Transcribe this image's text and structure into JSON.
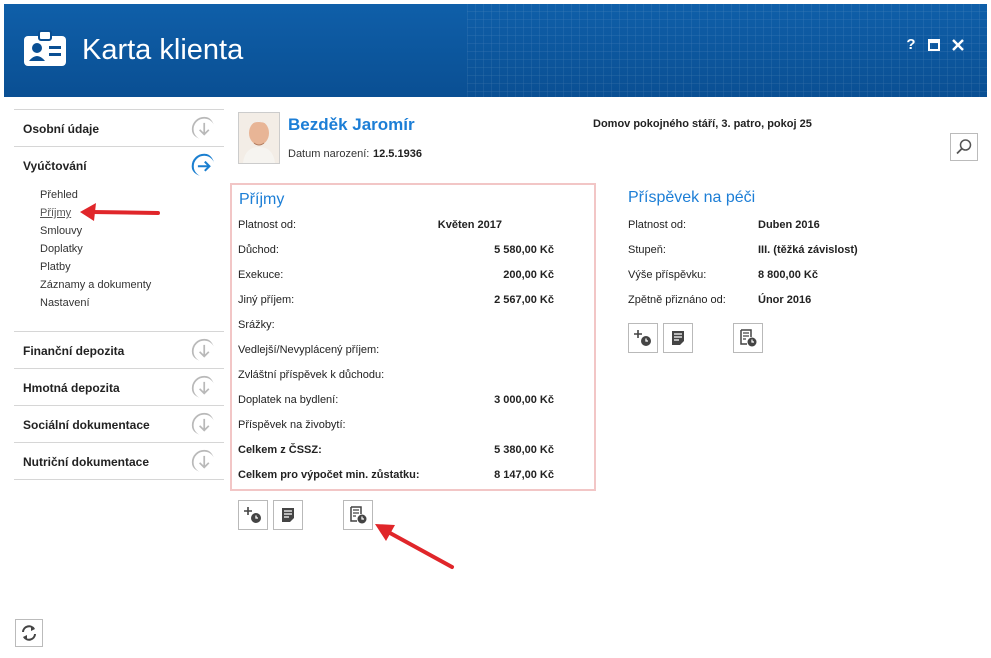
{
  "app": {
    "title": "Karta klienta",
    "help": "?"
  },
  "sidebar": {
    "sections": [
      {
        "label": "Osobní údaje"
      },
      {
        "label": "Vyúčtování"
      },
      {
        "label": "Finanční depozita"
      },
      {
        "label": "Hmotná depozita"
      },
      {
        "label": "Sociální dokumentace"
      },
      {
        "label": "Nutriční dokumentace"
      }
    ],
    "subitems": [
      "Přehled",
      "Příjmy",
      "Smlouvy",
      "Doplatky",
      "Platby",
      "Záznamy a dokumenty",
      "Nastavení"
    ]
  },
  "client": {
    "name": "Bezděk Jaromír",
    "birth_label": "Datum narození:",
    "birth_date": "12.5.1936",
    "residence": "Domov pokojného stáří, 3. patro, pokoj 25"
  },
  "income": {
    "title": "Příjmy",
    "rows": [
      {
        "label": "Platnost od:",
        "value": "Květen 2017"
      },
      {
        "label": "Důchod:",
        "value": "5 580,00 Kč"
      },
      {
        "label": "Exekuce:",
        "value": "200,00 Kč"
      },
      {
        "label": "Jiný příjem:",
        "value": "2 567,00 Kč"
      },
      {
        "label": "Srážky:",
        "value": ""
      },
      {
        "label": "Vedlejší/Nevyplácený příjem:",
        "value": ""
      },
      {
        "label": "Zvláštní příspěvek k důchodu:",
        "value": ""
      },
      {
        "label": "Doplatek na bydlení:",
        "value": "3 000,00 Kč"
      },
      {
        "label": "Příspěvek na živobytí:",
        "value": ""
      },
      {
        "label": "Celkem z ČSSZ:",
        "value": "5 380,00 Kč"
      },
      {
        "label": "Celkem pro výpočet min. zůstatku:",
        "value": "8 147,00 Kč"
      }
    ]
  },
  "care": {
    "title": "Příspěvek na péči",
    "rows": [
      {
        "label": "Platnost od:",
        "value": "Duben 2016"
      },
      {
        "label": "Stupeň:",
        "value": "III. (těžká závislost)"
      },
      {
        "label": "Výše příspěvku:",
        "value": "8 800,00 Kč"
      },
      {
        "label": "Zpětně přiznáno od:",
        "value": "Únor 2016"
      }
    ]
  },
  "colors": {
    "titlebar": "#0a4f93",
    "accent": "#1c7ed6",
    "highlight_border": "#f2c6c6",
    "annotation_arrow": "#e0262a"
  },
  "icons": [
    "id-card-icon",
    "search-icon",
    "add-history-icon",
    "document-icon",
    "history-document-icon",
    "refresh-icon",
    "chevron-down-icon",
    "arrow-right-icon"
  ]
}
